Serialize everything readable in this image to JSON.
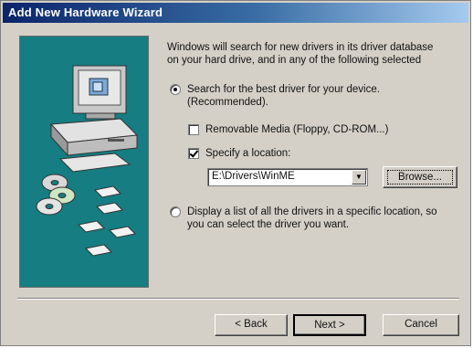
{
  "window": {
    "title": "Add New Hardware Wizard"
  },
  "intro": {
    "line1": "Windows will search for new drivers in its driver database",
    "line2": "on your hard drive, and in any of the following selected"
  },
  "options": {
    "search_best": {
      "line1": "Search for the best driver for your device.",
      "line2": "(Recommended).",
      "selected": true
    },
    "removable_media": {
      "label": "Removable Media (Floppy, CD-ROM...)",
      "checked": false
    },
    "specify_location": {
      "label": "Specify a location:",
      "checked": true
    },
    "location_value": "E:\\Drivers\\WinME",
    "display_list": {
      "line1": "Display a list of all the drivers in a specific location, so",
      "line2": "you can select the driver you want.",
      "selected": false
    }
  },
  "buttons": {
    "browse": "Browse...",
    "back": "< Back",
    "next": "Next >",
    "cancel": "Cancel"
  },
  "icons": {
    "wizard_art": "computer-with-discs-illustration",
    "combo_arrow": "chevron-down-icon"
  },
  "colors": {
    "titlebar_start": "#0a246a",
    "titlebar_end": "#a6caf0",
    "art_background": "#167d82",
    "face": "#d4d0c8"
  }
}
